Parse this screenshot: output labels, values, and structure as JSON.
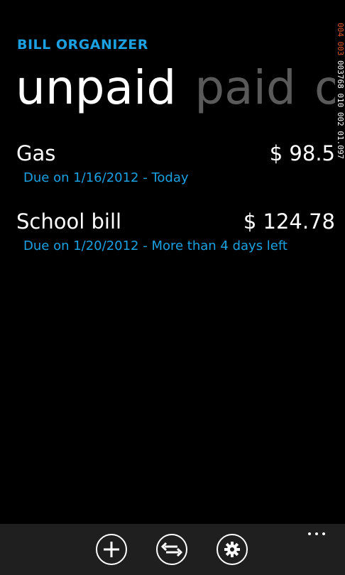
{
  "app": {
    "title": "BILL ORGANIZER"
  },
  "pivot": {
    "tabs": [
      {
        "label": "unpaid",
        "active": true
      },
      {
        "label": "paid",
        "active": false
      },
      {
        "label": "ov",
        "active": false
      }
    ]
  },
  "bills": [
    {
      "name": "Gas",
      "amount": "$ 98.5",
      "due": "Due on 1/16/2012 - Today"
    },
    {
      "name": "School bill",
      "amount": "$ 124.78",
      "due": "Due on 1/20/2012 - More than 4 days left"
    }
  ],
  "debug_overlay": {
    "red_text": "004 003",
    "white_text": "003768 010 002 01.097"
  },
  "app_bar": {
    "buttons": [
      {
        "name": "add",
        "icon": "plus-icon"
      },
      {
        "name": "sync",
        "icon": "sync-arrows-icon"
      },
      {
        "name": "settings",
        "icon": "gear-icon"
      }
    ],
    "more_icon": "ellipsis-icon"
  },
  "colors": {
    "background": "#000000",
    "accent": "#1ba1e2",
    "inactive_tab": "#5a5a5a",
    "app_bar": "#1f1f1f",
    "debug_red": "#e05a2b"
  }
}
